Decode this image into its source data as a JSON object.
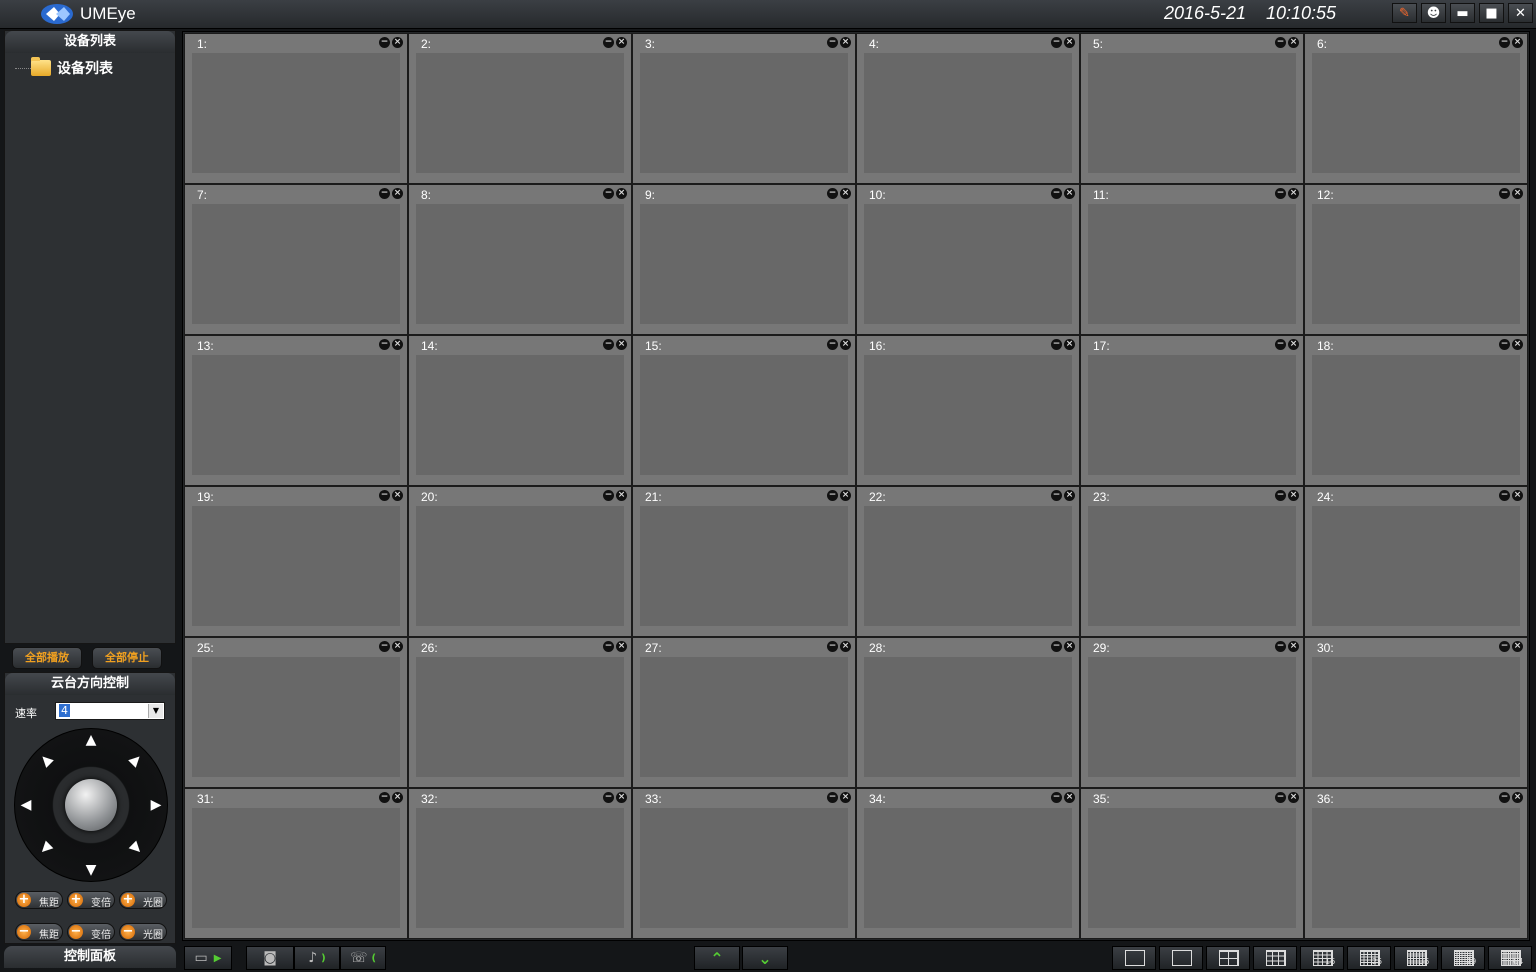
{
  "app": {
    "title": "UMEye",
    "date": "2016-5-21",
    "time": "10:10:55"
  },
  "window_buttons": [
    {
      "name": "lock-button",
      "icon": "pen-icon",
      "glyph": "✎"
    },
    {
      "name": "user-button",
      "icon": "user-icon",
      "glyph": "☻"
    },
    {
      "name": "minimize-button",
      "icon": "minimize-icon",
      "glyph": "▬"
    },
    {
      "name": "maximize-button",
      "icon": "maximize-icon",
      "glyph": "■"
    },
    {
      "name": "close-button",
      "icon": "close-icon",
      "glyph": "✕"
    }
  ],
  "device_list": {
    "header": "设备列表",
    "root_label": "设备列表"
  },
  "buttons": {
    "play_all": "全部播放",
    "stop_all": "全部停止"
  },
  "ptz": {
    "header": "云台方向控制",
    "speed_label": "速率",
    "speed_value": "4",
    "zoom_in": [
      {
        "label": "焦距",
        "sign": "+"
      },
      {
        "label": "变倍",
        "sign": "+"
      },
      {
        "label": "光圈",
        "sign": "+"
      }
    ],
    "zoom_out": [
      {
        "label": "焦距",
        "sign": "−"
      },
      {
        "label": "变倍",
        "sign": "−"
      },
      {
        "label": "光圈",
        "sign": "−"
      }
    ]
  },
  "control_panel": {
    "footer": "控制面板"
  },
  "channels": [
    "1:",
    "2:",
    "3:",
    "4:",
    "5:",
    "6:",
    "7:",
    "8:",
    "9:",
    "10:",
    "11:",
    "12:",
    "13:",
    "14:",
    "15:",
    "16:",
    "17:",
    "18:",
    "19:",
    "20:",
    "21:",
    "22:",
    "23:",
    "24:",
    "25:",
    "26:",
    "27:",
    "28:",
    "29:",
    "30:",
    "31:",
    "32:",
    "33:",
    "34:",
    "35:",
    "36:"
  ],
  "layouts": [
    "",
    "",
    "",
    "",
    "16",
    "25",
    "36",
    "49",
    "64"
  ],
  "colors": {
    "accent_orange": "#f0a020",
    "green_arrow": "#55cc33",
    "cell_bg": "#686868"
  }
}
